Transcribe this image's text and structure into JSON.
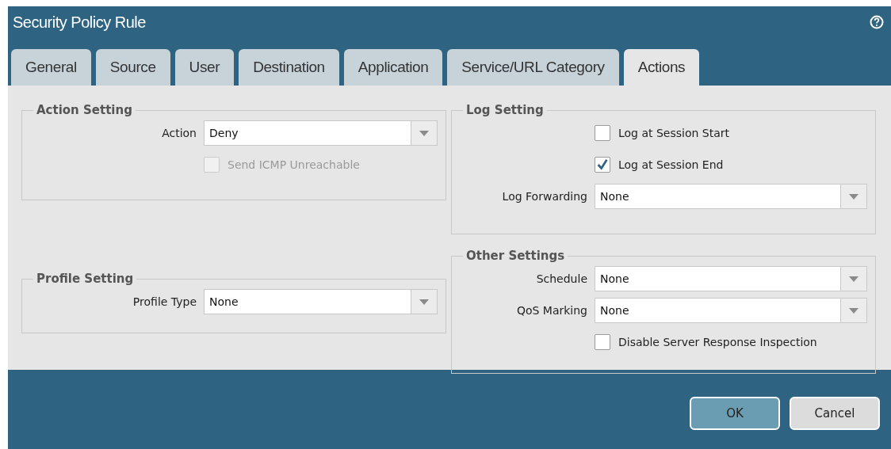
{
  "window": {
    "title": "Security Policy Rule"
  },
  "tabs": [
    {
      "label": "General",
      "selected": false
    },
    {
      "label": "Source",
      "selected": false
    },
    {
      "label": "User",
      "selected": false
    },
    {
      "label": "Destination",
      "selected": false
    },
    {
      "label": "Application",
      "selected": false
    },
    {
      "label": "Service/URL Category",
      "selected": false
    },
    {
      "label": "Actions",
      "selected": true
    }
  ],
  "left_sections": [
    {
      "title": "Action Setting",
      "rows": [
        {
          "kind": "select",
          "label": "Action",
          "value": "Deny"
        },
        {
          "kind": "checkbox",
          "label": "Send ICMP Unreachable",
          "checked": false,
          "disabled": true
        }
      ]
    },
    {
      "title": "Profile Setting",
      "rows": [
        {
          "kind": "select",
          "label": "Profile Type",
          "value": "None"
        }
      ]
    }
  ],
  "right_sections": [
    {
      "title": "Log Setting",
      "rows": [
        {
          "kind": "checkbox",
          "label": "Log at Session Start",
          "checked": false,
          "disabled": false
        },
        {
          "kind": "checkbox",
          "label": "Log at Session End",
          "checked": true,
          "disabled": false
        },
        {
          "kind": "select",
          "label": "Log Forwarding",
          "value": "None"
        }
      ]
    },
    {
      "title": "Other Settings",
      "rows": [
        {
          "kind": "select",
          "label": "Schedule",
          "value": "None"
        },
        {
          "kind": "select",
          "label": "QoS Marking",
          "value": "None"
        },
        {
          "kind": "checkbox",
          "label": "Disable Server Response Inspection",
          "checked": false,
          "disabled": false
        }
      ]
    }
  ],
  "buttons": [
    {
      "label": "OK",
      "kind": "primary"
    },
    {
      "label": "Cancel",
      "kind": "secondary"
    }
  ]
}
